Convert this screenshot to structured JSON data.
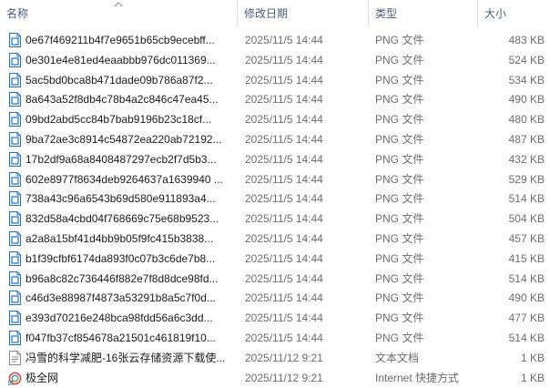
{
  "columns": {
    "name": "名称",
    "modified": "修改日期",
    "type": "类型",
    "size": "大小"
  },
  "files": [
    {
      "name": "0e67f469211b4f7e9651b65cb9ecebff...",
      "modified": "2025/11/5 14:44",
      "type": "PNG 文件",
      "size": "483 KB",
      "icon": "png-file-icon"
    },
    {
      "name": "0e301e4e81ed4eaabbb976dc011369...",
      "modified": "2025/11/5 14:44",
      "type": "PNG 文件",
      "size": "524 KB",
      "icon": "png-file-icon"
    },
    {
      "name": "5ac5bd0bca8b471dade09b786a87f2...",
      "modified": "2025/11/5 14:44",
      "type": "PNG 文件",
      "size": "534 KB",
      "icon": "png-file-icon"
    },
    {
      "name": "8a643a52f8db4c78b4a2c846c47ea45...",
      "modified": "2025/11/5 14:44",
      "type": "PNG 文件",
      "size": "490 KB",
      "icon": "png-file-icon"
    },
    {
      "name": "09bd2abd5cc84b7bab9196b23c18cf...",
      "modified": "2025/11/5 14:44",
      "type": "PNG 文件",
      "size": "480 KB",
      "icon": "png-file-icon"
    },
    {
      "name": "9ba72ae3c8914c54872ea220ab72192...",
      "modified": "2025/11/5 14:44",
      "type": "PNG 文件",
      "size": "487 KB",
      "icon": "png-file-icon"
    },
    {
      "name": "17b2df9a68a8408487297ecb2f7d5b3...",
      "modified": "2025/11/5 14:44",
      "type": "PNG 文件",
      "size": "432 KB",
      "icon": "png-file-icon"
    },
    {
      "name": "602e8977f8634deb9264637a1639940 ...",
      "modified": "2025/11/5 14:44",
      "type": "PNG 文件",
      "size": "529 KB",
      "icon": "png-file-icon"
    },
    {
      "name": "738a43c96a6543b69d580e911893a4...",
      "modified": "2025/11/5 14:44",
      "type": "PNG 文件",
      "size": "514 KB",
      "icon": "png-file-icon"
    },
    {
      "name": "832d58a4cbd04f768669c75e68b9523...",
      "modified": "2025/11/5 14:44",
      "type": "PNG 文件",
      "size": "504 KB",
      "icon": "png-file-icon"
    },
    {
      "name": "a2a8a15bf41d4bb9b05f9fc415b3838...",
      "modified": "2025/11/5 14:44",
      "type": "PNG 文件",
      "size": "457 KB",
      "icon": "png-file-icon"
    },
    {
      "name": "b1f39cfbf6174da893f0c07b3c6de7b8...",
      "modified": "2025/11/5 14:44",
      "type": "PNG 文件",
      "size": "415 KB",
      "icon": "png-file-icon"
    },
    {
      "name": "b96a8c82c736446f882e7f8d8dce98fd...",
      "modified": "2025/11/5 14:44",
      "type": "PNG 文件",
      "size": "514 KB",
      "icon": "png-file-icon"
    },
    {
      "name": "c46d3e88987f4873a53291b8a5c7f0d...",
      "modified": "2025/11/5 14:44",
      "type": "PNG 文件",
      "size": "490 KB",
      "icon": "png-file-icon"
    },
    {
      "name": "e393d70216e248bca98fdd56a6c3dd...",
      "modified": "2025/11/5 14:44",
      "type": "PNG 文件",
      "size": "477 KB",
      "icon": "png-file-icon"
    },
    {
      "name": "f047fb37cf854678a21501c461819f10...",
      "modified": "2025/11/5 14:44",
      "type": "PNG 文件",
      "size": "514 KB",
      "icon": "png-file-icon"
    },
    {
      "name": "冯雪的科学减肥-16张云存储资源下载使...",
      "modified": "2025/11/12 9:21",
      "type": "文本文档",
      "size": "1 KB",
      "icon": "text-file-icon"
    },
    {
      "name": "极全网",
      "modified": "2025/11/12 9:21",
      "type": "Internet 快捷方式",
      "size": "1 KB",
      "icon": "internet-shortcut-icon"
    }
  ],
  "colors": {
    "header_text": "#4c607a",
    "name_text": "#1a1a1a",
    "meta_text": "#6d6d6d",
    "png_icon_accent": "#1f6fd1",
    "text_icon_border": "#8a8a8a",
    "shortcut_icon_red": "#e23a2e"
  }
}
